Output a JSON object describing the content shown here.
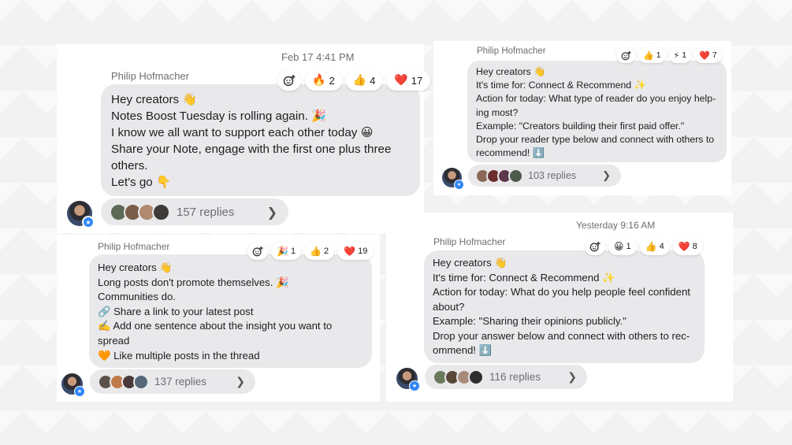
{
  "posts": [
    {
      "timestamp": "Feb 17 4:41 PM",
      "author": "Philip Hofmacher",
      "reactions": [
        {
          "emoji": "🔥",
          "count": "2"
        },
        {
          "emoji": "👍",
          "count": "4"
        },
        {
          "emoji": "❤️",
          "count": "17"
        }
      ],
      "lines": [
        "Hey creators 👋",
        "Notes Boost Tuesday is rolling again. 🎉",
        "I know we all want to support each other today 😀",
        "Share your Note, engage with the first one plus three",
        "others.",
        "Let's go 👇"
      ],
      "replies": "157 replies"
    },
    {
      "author": "Philip Hofmacher",
      "reactions": [
        {
          "emoji": "👍",
          "count": "1"
        },
        {
          "emoji": "⚡",
          "count": "1"
        },
        {
          "emoji": "❤️",
          "count": "7"
        }
      ],
      "lines": [
        "Hey creators 👋",
        "It's time for: Connect & Recommend ✨",
        "Action for today: What type of reader do you enjoy help-",
        "ing most?",
        "Example: \"Creators building their first paid offer.\"",
        "Drop your reader type below and connect with others to",
        "recommend! ⬇️"
      ],
      "replies": "103 replies"
    },
    {
      "author": "Philip Hofmacher",
      "reactions": [
        {
          "emoji": "🎉",
          "count": "1"
        },
        {
          "emoji": "👍",
          "count": "2"
        },
        {
          "emoji": "❤️",
          "count": "19"
        }
      ],
      "lines": [
        "Hey creators 👋",
        "Long posts don't promote themselves. 🎉",
        "Communities do.",
        "🔗 Share a link to your latest post",
        "✍️ Add one sentence about the insight you want to",
        "spread",
        "🧡 Like multiple posts in the thread"
      ],
      "replies": "137 replies"
    },
    {
      "timestamp": "Yesterday 9:16 AM",
      "author": "Philip Hofmacher",
      "reactions": [
        {
          "emoji": "😀",
          "count": "1"
        },
        {
          "emoji": "👍",
          "count": "4"
        },
        {
          "emoji": "❤️",
          "count": "8"
        }
      ],
      "lines": [
        "Hey creators 👋",
        "It's time for: Connect & Recommend ✨",
        "Action for today: What do you help people feel confident",
        "about?",
        "Example: \"Sharing their opinions publicly.\"",
        "Drop your answer below and connect with others to rec-",
        "ommend! ⬇️"
      ],
      "replies": "116 replies"
    }
  ],
  "icons": {
    "add_reaction": "add-reaction-icon",
    "chevron": "chevron-right-icon",
    "verified": "star-badge-icon"
  },
  "colors": {
    "bubble": "#e9e9eb",
    "badge": "#2f86f6",
    "muted_text": "#6e6e73"
  }
}
